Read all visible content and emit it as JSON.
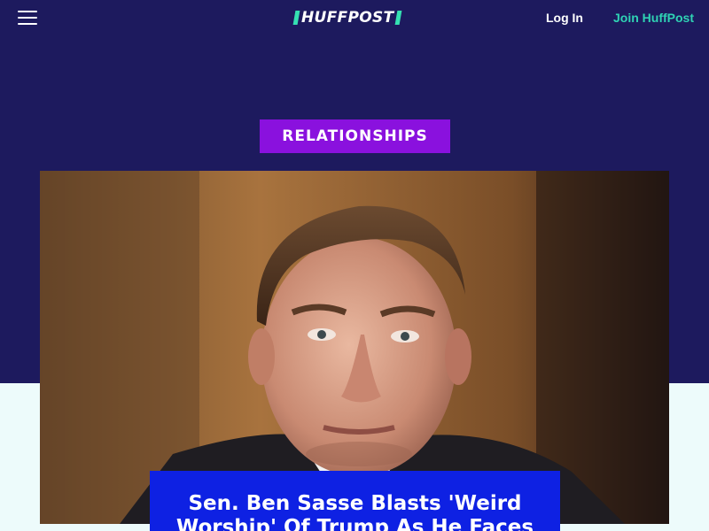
{
  "header": {
    "menu_icon": "hamburger-menu-icon",
    "logo_text": "HUFFPOST",
    "login_label": "Log In",
    "join_label": "Join HuffPost"
  },
  "article": {
    "section_label": "RELATIONSHIPS",
    "headline": "Sen. Ben Sasse Blasts 'Weird Worship' Of Trump As He Faces"
  },
  "colors": {
    "header_bg": "#1d1a5e",
    "accent_teal": "#2fd3b4",
    "section_tag_bg": "#8a11de",
    "headline_bg": "#0e21e3",
    "page_bg": "#edfbfb"
  }
}
